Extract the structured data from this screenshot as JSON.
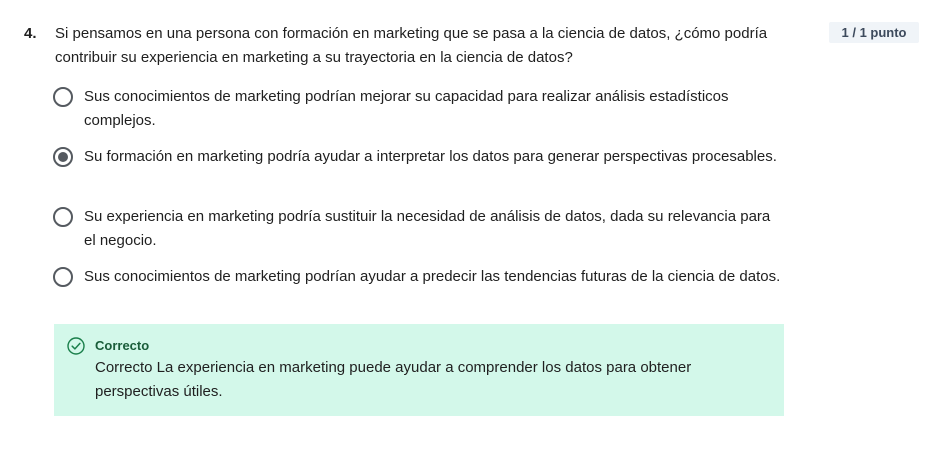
{
  "question": {
    "number": "4.",
    "text": "Si pensamos en una persona con formación en marketing que se pasa a la ciencia de datos, ¿cómo podría contribuir su experiencia en marketing a su trayectoria en la ciencia de datos?",
    "score": "1 / 1 punto"
  },
  "options": [
    {
      "label": "Sus conocimientos de marketing podrían mejorar su capacidad para realizar análisis estadísticos complejos.",
      "selected": false
    },
    {
      "label": "Su formación en marketing podría ayudar a interpretar los datos para generar perspectivas procesables.",
      "selected": true
    },
    {
      "label": "Su experiencia en marketing podría sustituir la necesidad de análisis de datos, dada su relevancia para el negocio.",
      "selected": false
    },
    {
      "label": "Sus conocimientos de marketing podrían ayudar a predecir las tendencias futuras de la ciencia de datos.",
      "selected": false
    }
  ],
  "feedback": {
    "title": "Correcto",
    "text": "Correcto La experiencia en marketing puede ayudar a comprender los datos para obtener perspectivas útiles.",
    "icon": "check-circle-icon",
    "color": "#1a7f4b",
    "background": "#d3f8ea"
  }
}
